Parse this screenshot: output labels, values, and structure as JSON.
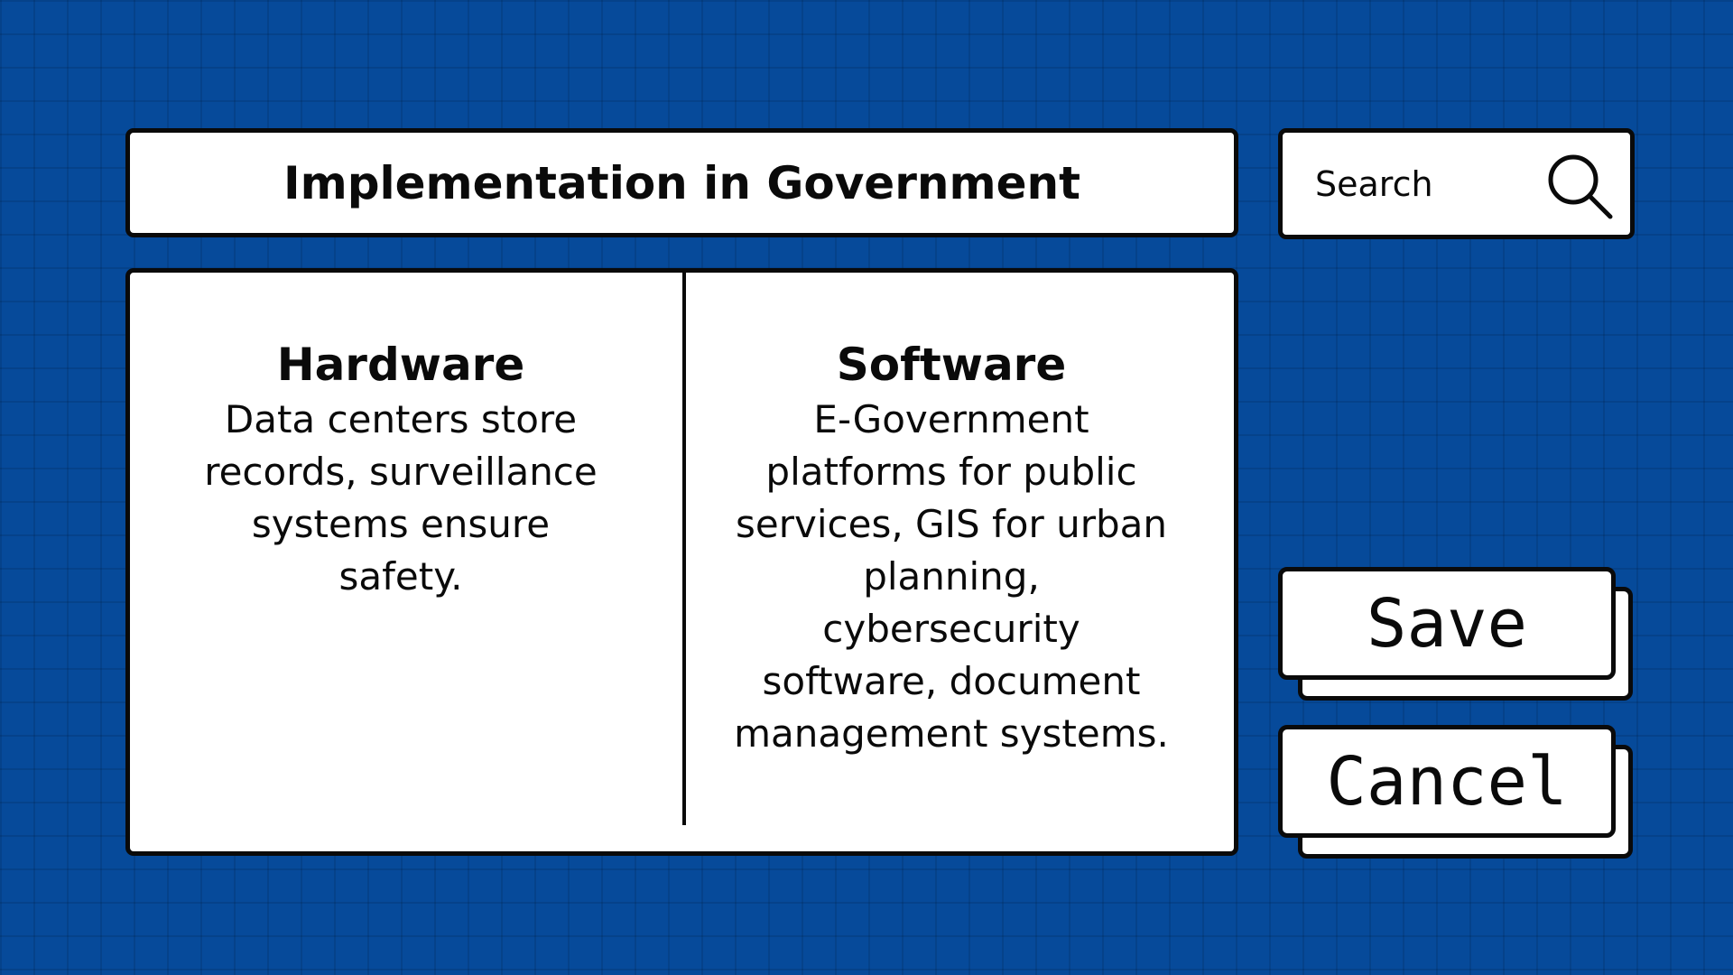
{
  "header": {
    "title": "Implementation in Government"
  },
  "search": {
    "placeholder": "Search",
    "icon": "search-icon"
  },
  "content": {
    "columns": [
      {
        "title": "Hardware",
        "body": "Data centers store records, surveillance systems ensure safety."
      },
      {
        "title": "Software",
        "body": "E-Government platforms for public services, GIS for urban planning, cybersecurity software, document management systems."
      }
    ]
  },
  "actions": {
    "save_label": "Save",
    "cancel_label": "Cancel"
  },
  "colors": {
    "background": "#064a9a",
    "panel": "#ffffff",
    "border": "#0a0a0a"
  }
}
